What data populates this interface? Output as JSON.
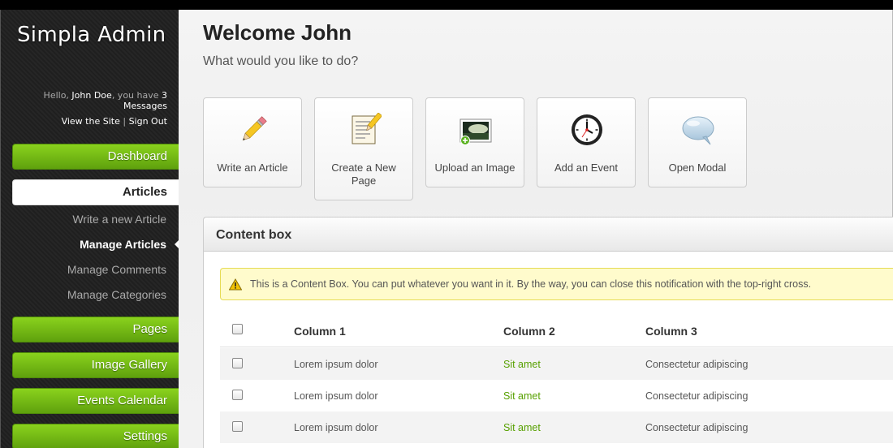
{
  "sidebar": {
    "logo": "Simpla Admin",
    "profile": {
      "greeting_prefix": "Hello, ",
      "user": "John Doe",
      "greeting_mid": ", you have ",
      "messages": "3 Messages",
      "view_site": "View the Site",
      "separator": " | ",
      "sign_out": "Sign Out"
    },
    "nav": {
      "dashboard": "Dashboard",
      "articles": "Articles",
      "pages": "Pages",
      "image_gallery": "Image Gallery",
      "events_calendar": "Events Calendar",
      "settings": "Settings"
    },
    "articles_sub": [
      "Write a new Article",
      "Manage Articles",
      "Manage Comments",
      "Manage Categories"
    ]
  },
  "main": {
    "welcome": "Welcome John",
    "subtitle": "What would you like to do?",
    "shortcuts": [
      {
        "label": "Write an Article",
        "icon": "pencil-icon"
      },
      {
        "label": "Create a New Page",
        "icon": "new-page-icon"
      },
      {
        "label": "Upload an Image",
        "icon": "image-upload-icon"
      },
      {
        "label": "Add an Event",
        "icon": "clock-icon"
      },
      {
        "label": "Open Modal",
        "icon": "speech-bubble-icon"
      }
    ],
    "content_box": {
      "title": "Content box",
      "notification": "This is a Content Box. You can put whatever you want in it. By the way, you can close this notification with the top-right cross.",
      "table": {
        "headers": [
          "Column 1",
          "Column 2",
          "Column 3"
        ],
        "rows": [
          [
            "Lorem ipsum dolor",
            "Sit amet",
            "Consectetur adipiscing"
          ],
          [
            "Lorem ipsum dolor",
            "Sit amet",
            "Consectetur adipiscing"
          ],
          [
            "Lorem ipsum dolor",
            "Sit amet",
            "Consectetur adipiscing"
          ]
        ]
      }
    }
  },
  "colors": {
    "nav_green": "#6fb814",
    "link_green": "#57a000",
    "notification_bg": "#fffbcc"
  }
}
